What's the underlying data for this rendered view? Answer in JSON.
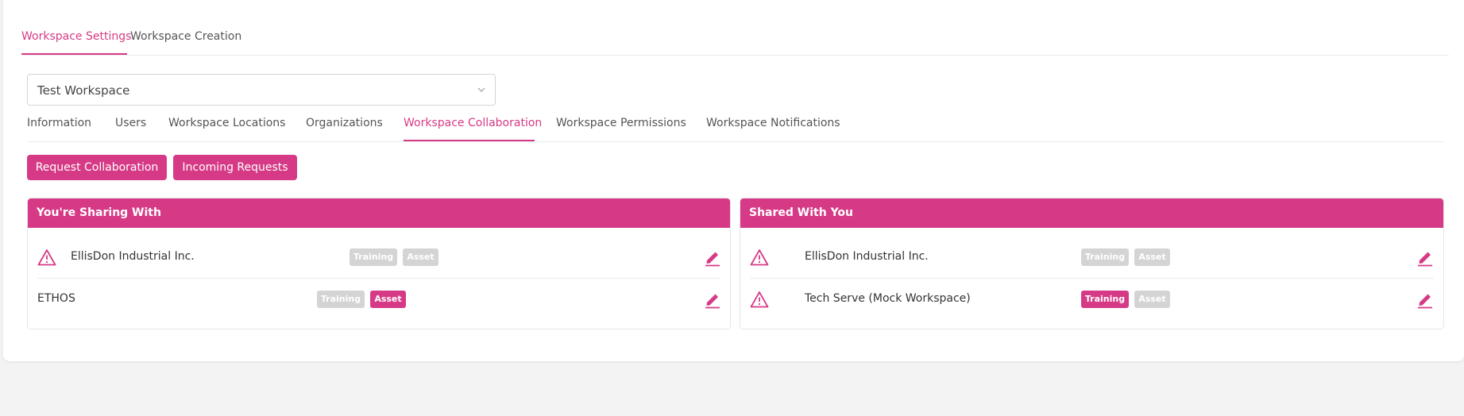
{
  "top_tabs": [
    {
      "label": "Workspace Settings",
      "active": true
    },
    {
      "label": "Workspace Creation",
      "active": false
    }
  ],
  "workspace_select": {
    "value": "Test Workspace"
  },
  "sub_tabs": [
    {
      "label": "Information",
      "active": false
    },
    {
      "label": "Users",
      "active": false
    },
    {
      "label": "Workspace Locations",
      "active": false
    },
    {
      "label": "Organizations",
      "active": false
    },
    {
      "label": "Workspace Collaboration",
      "active": true
    },
    {
      "label": "Workspace Permissions",
      "active": false
    },
    {
      "label": "Workspace Notifications",
      "active": false
    }
  ],
  "buttons": {
    "request_collaboration": "Request Collaboration",
    "incoming_requests": "Incoming Requests"
  },
  "sharing_with": {
    "title": "You're Sharing With",
    "rows": [
      {
        "name": "EllisDon Industrial Inc.",
        "warning": true,
        "tags": [
          {
            "label": "Training",
            "active": false
          },
          {
            "label": "Asset",
            "active": false
          }
        ]
      },
      {
        "name": "ETHOS",
        "warning": false,
        "tags": [
          {
            "label": "Training",
            "active": false
          },
          {
            "label": "Asset",
            "active": true
          }
        ]
      }
    ]
  },
  "shared_with_you": {
    "title": "Shared With You",
    "rows": [
      {
        "name": "EllisDon Industrial Inc.",
        "warning": true,
        "tags": [
          {
            "label": "Training",
            "active": false
          },
          {
            "label": "Asset",
            "active": false
          }
        ]
      },
      {
        "name": "Tech Serve (Mock Workspace)",
        "warning": true,
        "tags": [
          {
            "label": "Training",
            "active": true
          },
          {
            "label": "Asset",
            "active": false
          }
        ]
      }
    ]
  },
  "colors": {
    "accent": "#d63a86",
    "tag_inactive": "#d4d4d4",
    "background": "#f3f3f3"
  },
  "icons": {
    "warning": "warning-triangle-icon",
    "edit": "pencil-icon",
    "select": "chevron-down-icon"
  }
}
